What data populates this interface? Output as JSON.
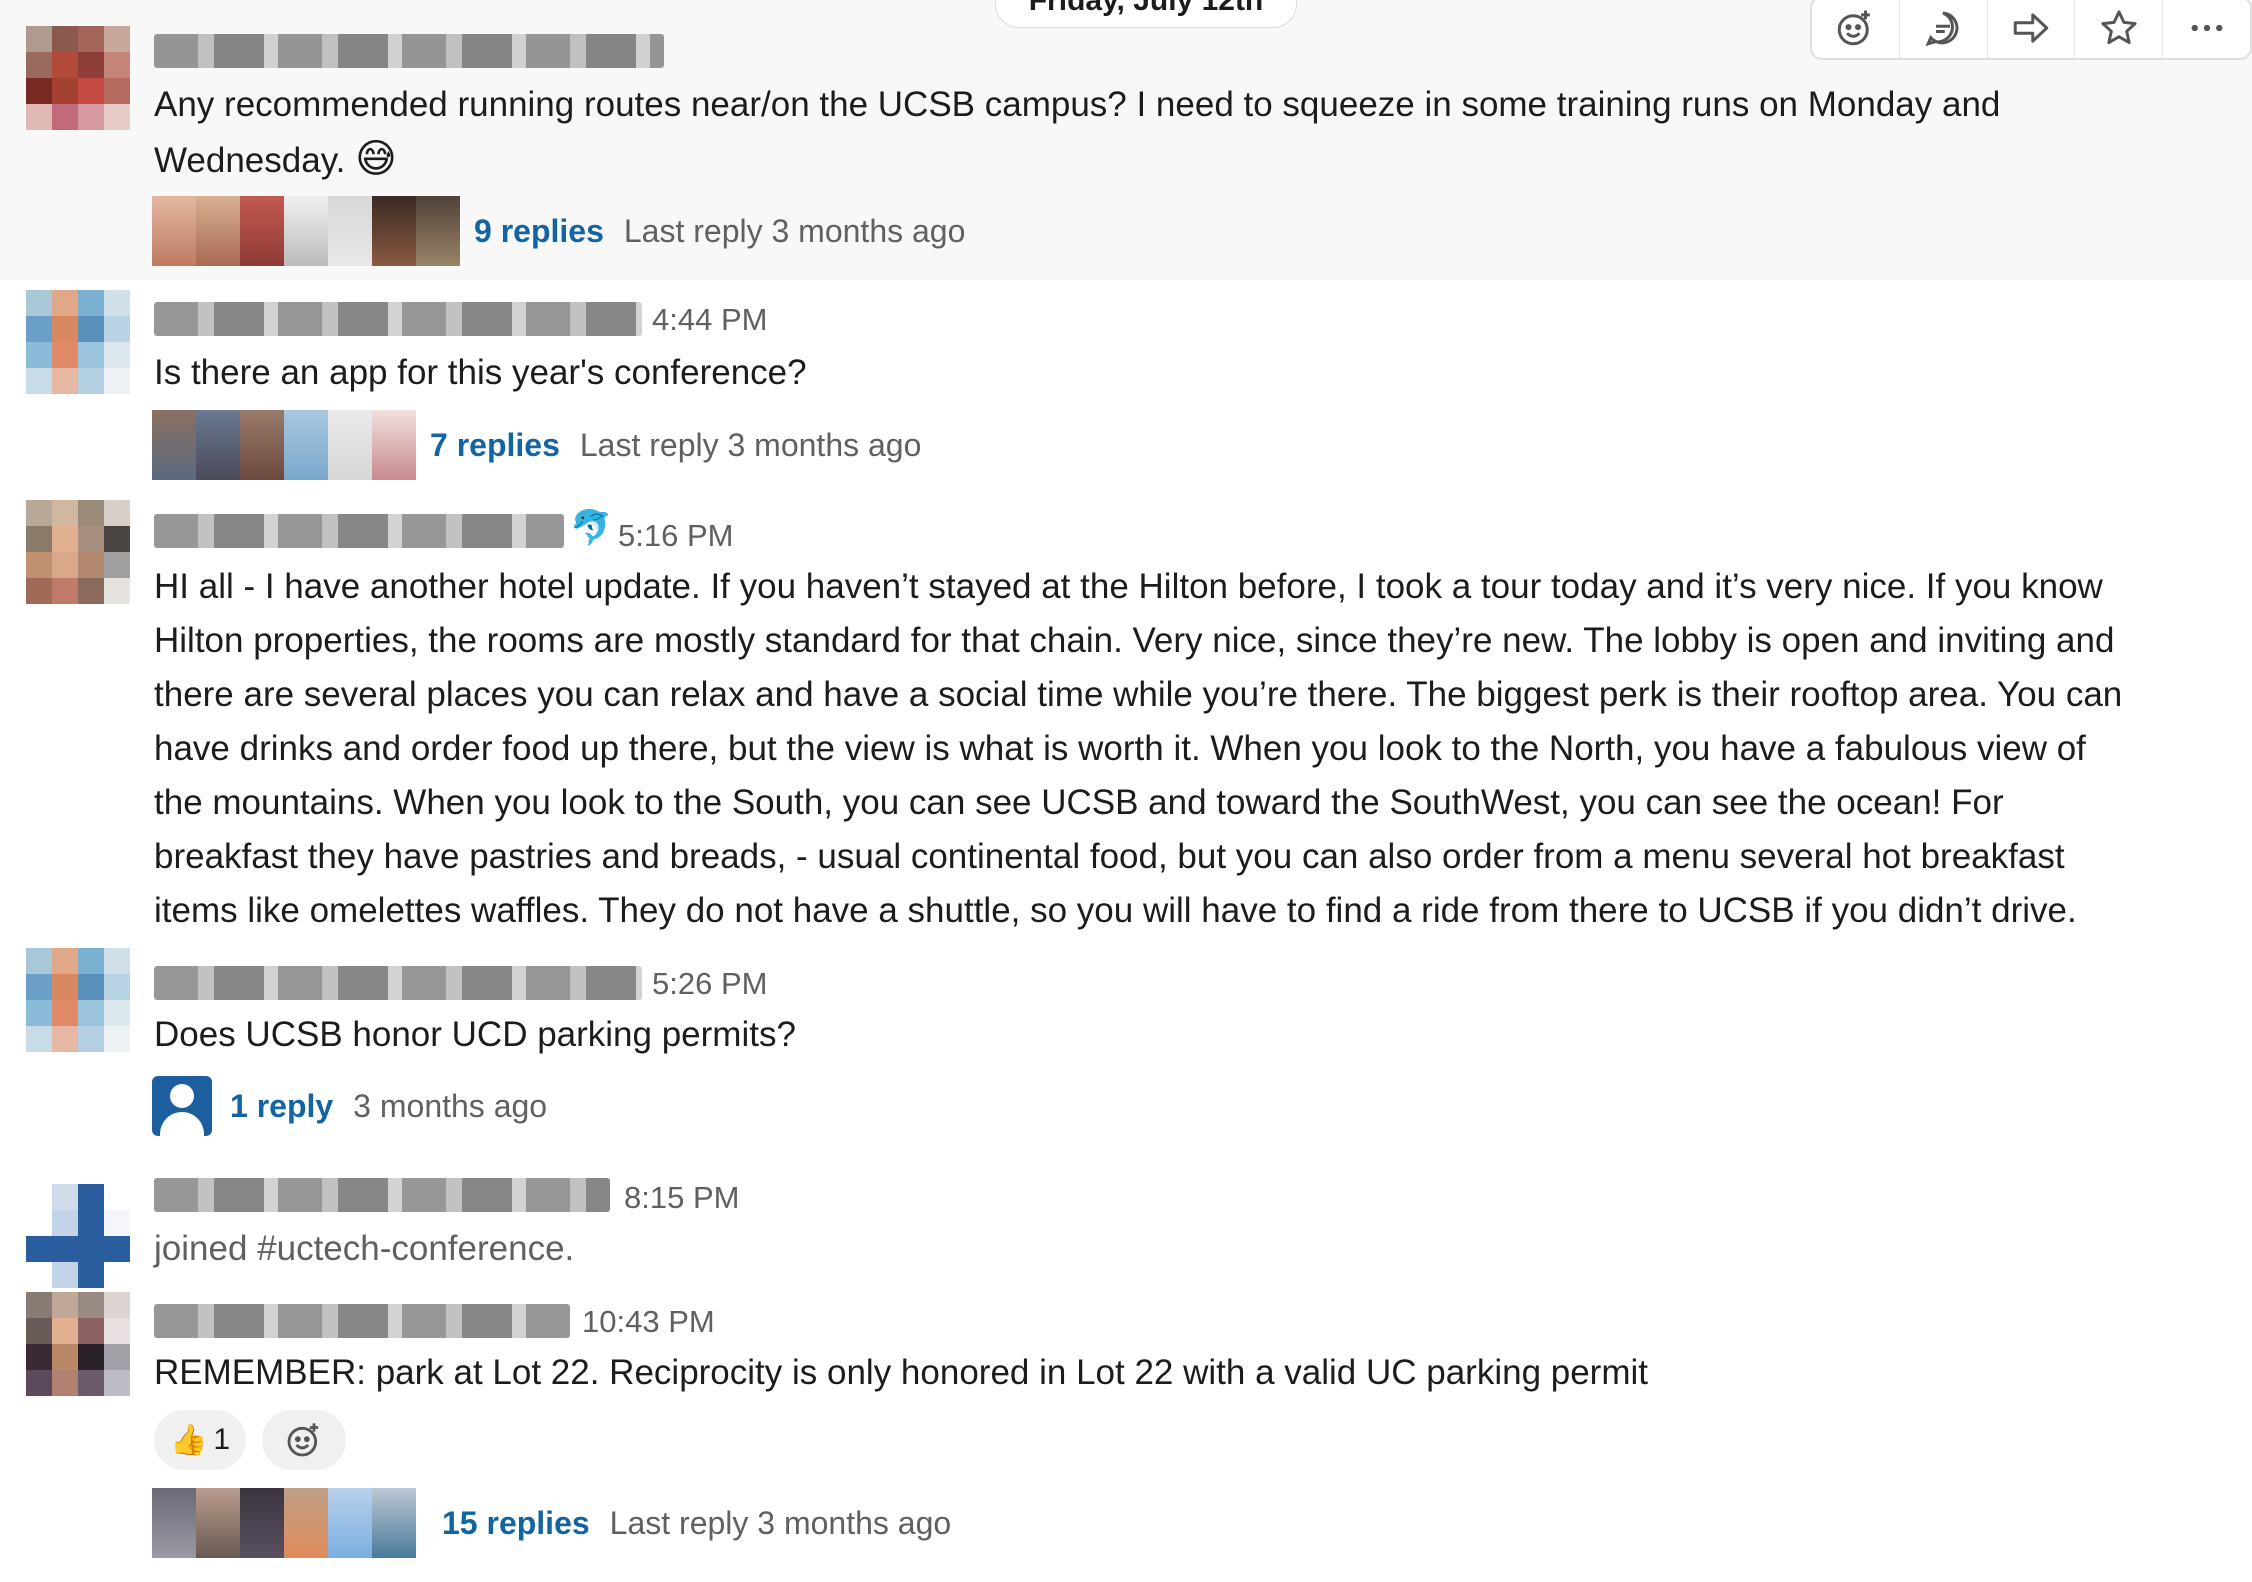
{
  "date_divider": "Friday, July 12th",
  "message_actions": [
    "add-reaction",
    "reply-in-thread",
    "share-message",
    "save",
    "more-actions"
  ],
  "messages": [
    {
      "id": "m1",
      "text": "Any recommended running routes near/on the UCSB campus? I need to squeeze in some training runs on Monday and Wednesday.",
      "emoji": "😅",
      "thread": {
        "replies": "9 replies",
        "last_reply": "Last reply 3 months ago"
      }
    },
    {
      "id": "m2",
      "time": "4:44 PM",
      "text": "Is there an app for this year's conference?",
      "thread": {
        "replies": "7 replies",
        "last_reply": "Last reply 3 months ago"
      }
    },
    {
      "id": "m3",
      "time": "5:16 PM",
      "status_emoji": "🐬",
      "lines": [
        "HI all - I have another hotel update. If you haven’t stayed at the Hilton before, I took a tour today and it’s very nice.   If you know",
        "Hilton properties, the rooms are mostly standard for that chain. Very nice, since they’re new. The lobby is open and inviting and",
        "there are several places you can relax and have a social time while you’re there. The biggest perk is their rooftop area. You can",
        "have drinks and order food up there, but the view is what is worth it. When you look to the North, you have a fabulous view of",
        "the mountains. When you look to the South, you can see UCSB and toward the SouthWest, you can see the ocean! For",
        "breakfast they have pastries and breads,  - usual continental food, but you can also order from a menu several hot breakfast",
        "items like omelettes waffles. They do not have a shuttle, so you will have to find a ride from there to UCSB if you didn’t drive."
      ]
    },
    {
      "id": "m4",
      "time": "5:26 PM",
      "text": "Does UCSB honor UCD parking permits?",
      "thread": {
        "replies": "1 reply",
        "last_reply": "3 months ago"
      }
    },
    {
      "id": "m5",
      "time": "8:15 PM",
      "text": "joined #uctech-conference."
    },
    {
      "id": "m6",
      "time": "10:43 PM",
      "text": "REMEMBER: park at Lot 22.  Reciprocity is only honored in Lot 22 with a valid UC parking permit",
      "reaction": {
        "emoji": "👍",
        "count": "1"
      },
      "thread": {
        "replies": "15 replies",
        "last_reply": "Last reply 3 months ago"
      }
    }
  ],
  "colors": {
    "link": "#1264a3",
    "muted": "#616061",
    "text": "#1d1c1d",
    "hover": "#f8f8f8"
  }
}
